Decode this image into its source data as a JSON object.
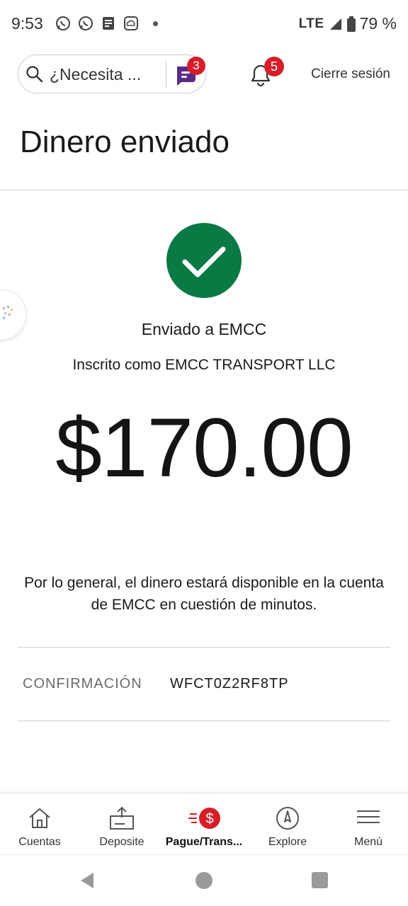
{
  "status_bar": {
    "time": "9:53",
    "network": "LTE",
    "battery": "79 %",
    "notification_icons": [
      "whatsapp-icon",
      "whatsapp-icon",
      "news-icon",
      "weather-icon"
    ]
  },
  "header": {
    "search_placeholder": "¿Necesita ...",
    "chat_badge": "3",
    "notifications_badge": "5",
    "signout_label": "Cierre sesión"
  },
  "page": {
    "title": "Dinero enviado"
  },
  "confirmation_screen": {
    "sent_to": "Enviado a EMCC",
    "enrolled_as": "Inscrito como EMCC TRANSPORT LLC",
    "amount": "$170.00",
    "note": "Por lo general, el dinero estará disponible en la cuenta de EMCC en cuestión de minutos.",
    "confirmation_label": "CONFIRMACIÓN",
    "confirmation_code": "WFCT0Z2RF8TP"
  },
  "bottom_nav": {
    "items": [
      {
        "label": "Cuentas",
        "icon": "home-icon",
        "active": false
      },
      {
        "label": "Deposite",
        "icon": "deposit-icon",
        "active": false
      },
      {
        "label": "Pague/Trans...",
        "icon": "pay-transfer-icon",
        "active": true
      },
      {
        "label": "Explore",
        "icon": "compass-icon",
        "active": false
      },
      {
        "label": "Menú",
        "icon": "menu-icon",
        "active": false
      }
    ]
  },
  "colors": {
    "success_green": "#0a7a45",
    "badge_red": "#d71e28",
    "chat_purple": "#5b2a86"
  }
}
